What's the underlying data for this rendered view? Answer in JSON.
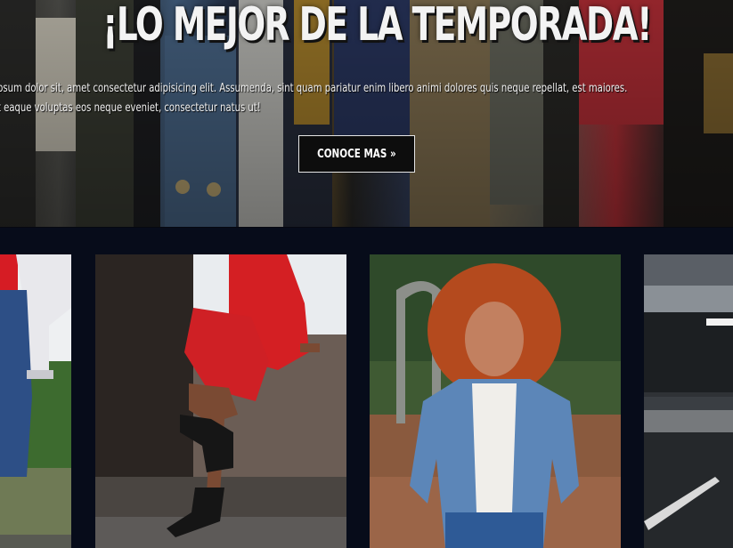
{
  "hero": {
    "title": "¡LO MEJOR DE LA TEMPORADA!",
    "text_line1": "psum dolor sit, amet consectetur adipisicing elit. Assumenda, sint quam pariatur enim libero animi dolores quis neque repellat, est maiores.",
    "text_line2": "t eaque voluptas eos neque eveniet, consectetur natus ut!",
    "cta_label": "CONOCE MAS »"
  },
  "colors": {
    "background": "#060b18",
    "button_bg": "#0d0d0d",
    "button_border": "#e5e5e5",
    "title": "#f3f3f3"
  },
  "gallery": {
    "cards": [
      {
        "name": "model-white-cardigan-jeans"
      },
      {
        "name": "model-red-suit-black-boots"
      },
      {
        "name": "model-curly-hair-denim-jacket"
      },
      {
        "name": "parking-garage-scene"
      }
    ]
  }
}
